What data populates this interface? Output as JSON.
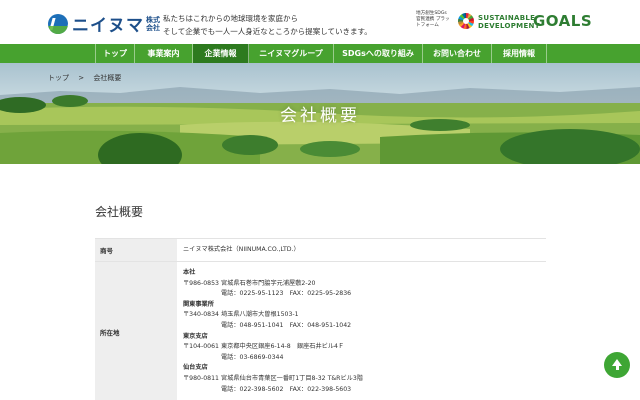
{
  "header": {
    "logo_text": "ニイヌマ",
    "logo_suffix": "株式会社",
    "tagline_line1": "私たちはこれからの地球環境を家庭から",
    "tagline_line2": "そして企業でも一人一人身近なところから提案していきます。",
    "sdgs_partner": "地方創生SDGs 官民連携 プラットフォーム",
    "sdgs_line1": "SUSTAINABLE",
    "sdgs_line2": "DEVELOPMENT",
    "sdgs_goals": "GOALS"
  },
  "nav": {
    "items": [
      {
        "label": "トップ"
      },
      {
        "label": "事業案内"
      },
      {
        "label": "企業情報"
      },
      {
        "label": "ニイヌマグループ"
      },
      {
        "label": "SDGsへの取り組み"
      },
      {
        "label": "お問い合わせ"
      },
      {
        "label": "採用情報"
      }
    ],
    "active_index": 2
  },
  "breadcrumb": {
    "home": "トップ",
    "separator": ">",
    "current": "会社概要"
  },
  "hero": {
    "title": "会社概要"
  },
  "main": {
    "section_title": "会社概要",
    "table": {
      "name_label": "商号",
      "name_value": "ニイヌマ株式会社（NIINUMA.CO.,LTD.）",
      "address_label": "所在地",
      "offices": [
        {
          "name": "本社",
          "postal": "〒986-0853",
          "address": "宮城県石巻市門脇字元浦屋敷2-20",
          "tel": "電話：0225-95-1123　FAX：0225-95-2836"
        },
        {
          "name": "関東事業所",
          "postal": "〒340-0834",
          "address": "埼玉県八潮市大曽根1503-1",
          "tel": "電話：048-951-1041　FAX：048-951-1042"
        },
        {
          "name": "東京支店",
          "postal": "〒104-0061",
          "address": "東京都中央区銀座6-14-8　銀座石井ビル4Ｆ",
          "tel": "電話：03-6869-0344"
        },
        {
          "name": "仙台支店",
          "postal": "〒980-0811",
          "address": "宮城県仙台市青葉区一番町1丁目8-32 T&Rビル3階",
          "tel": "電話：022-398-5602　FAX：022-398-5603"
        }
      ]
    }
  },
  "colors": {
    "nav_green": "#47a22f",
    "nav_active": "#2d7a1f",
    "brand_blue": "#1d4f8a",
    "to_top_green": "#3ea634"
  }
}
